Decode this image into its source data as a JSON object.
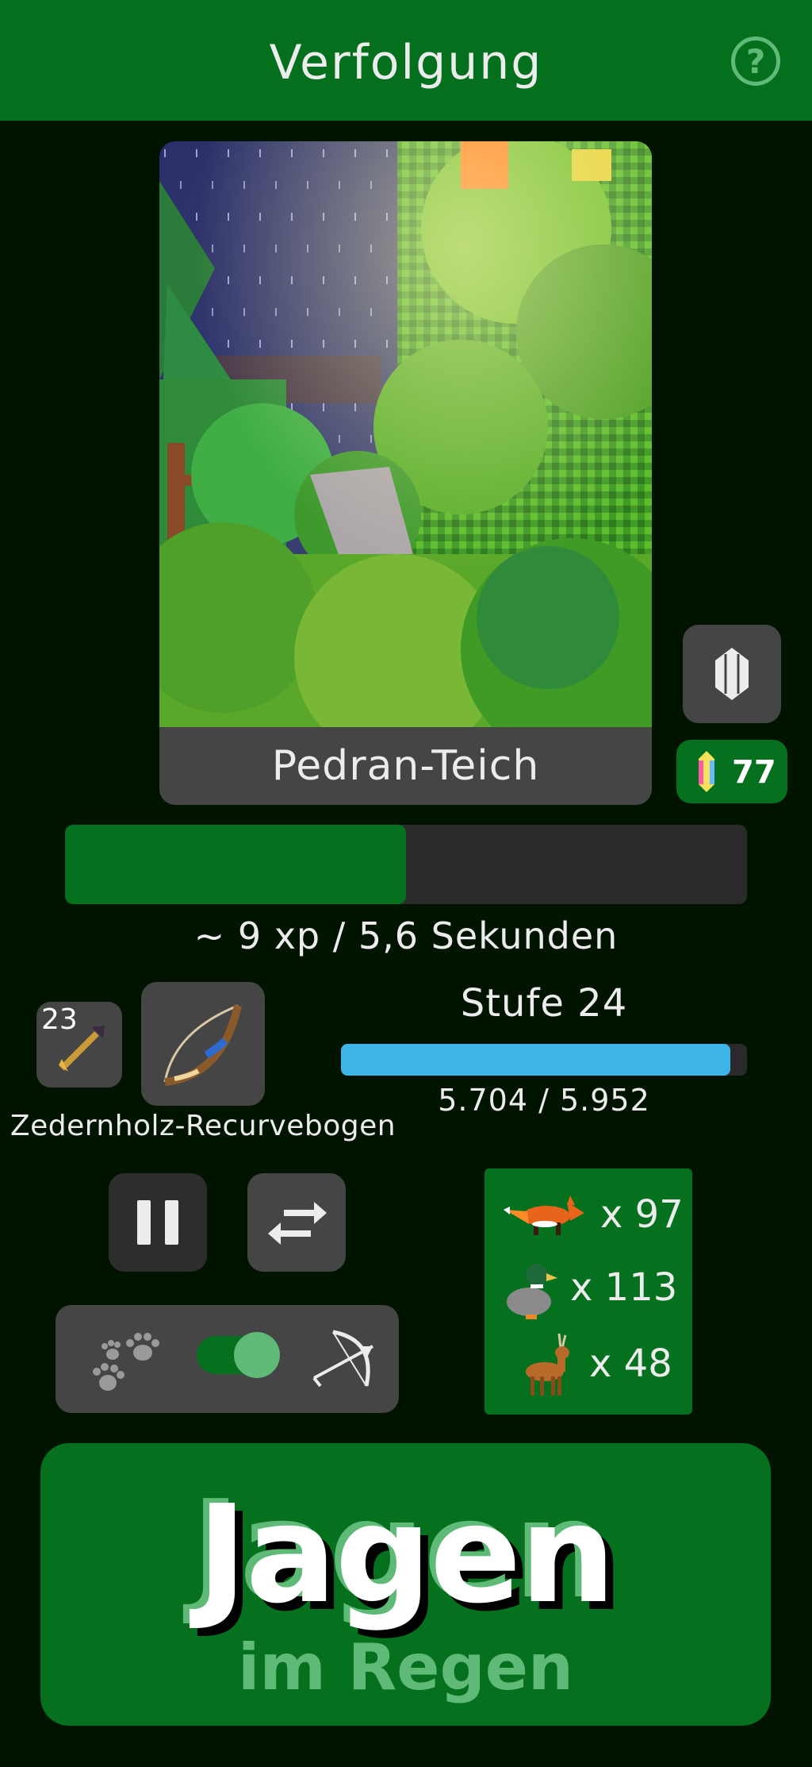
{
  "header": {
    "title": "Verfolgung",
    "help_icon": "question-circle-icon"
  },
  "location": {
    "name": "Pedran-Teich",
    "weather": "rain"
  },
  "gems": {
    "icon": "crystal-icon",
    "count": "77"
  },
  "activity": {
    "progress": 0.5,
    "rate_text": "~ 9 xp / 5,6 Sekunden"
  },
  "equipment": {
    "ammo_count": "23",
    "ammo_icon": "arrow-icon",
    "weapon_icon": "recurve-bow-icon",
    "weapon_name": "Zedernholz-Recurvebogen"
  },
  "level": {
    "label": "Stufe 24",
    "xp_text": "5.704 / 5.952",
    "current": 5704,
    "max": 5952
  },
  "controls": {
    "pause_icon": "pause-icon",
    "swap_icon": "swap-arrows-icon",
    "mode_left_icon": "paw-prints-icon",
    "mode_right_icon": "bow-arrow-icon",
    "mode_toggle_on": true
  },
  "catches": [
    {
      "animal": "fox",
      "icon": "fox-icon",
      "count": "x 97"
    },
    {
      "animal": "duck",
      "icon": "duck-icon",
      "count": "x 113"
    },
    {
      "animal": "deer",
      "icon": "deer-icon",
      "count": "x 48"
    }
  ],
  "hunt_button": {
    "title": "Jagen",
    "subtitle": "im Regen"
  },
  "colors": {
    "primary_green": "#05701d",
    "accent_green": "#5fba78",
    "xp_blue": "#3eb4e8",
    "panel_gray": "#454545"
  }
}
